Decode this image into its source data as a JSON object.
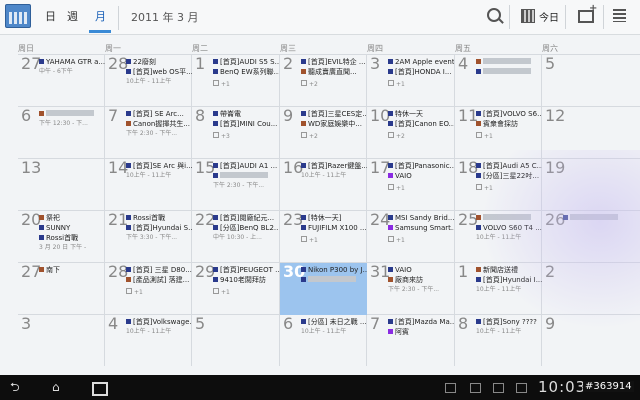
{
  "topbar": {
    "views": [
      {
        "label": "日"
      },
      {
        "label": "週"
      },
      {
        "label": "月"
      }
    ],
    "month_title": "2011 年 3 月",
    "today_label": "今日",
    "icons": {
      "search": "search-icon",
      "today": "calendar-today-icon",
      "add": "add-event-icon",
      "menu": "menu-icon"
    }
  },
  "colors": {
    "today_bg": "#9cc4ee",
    "accent": "#3a8ad6",
    "navy": "#2a3a8c",
    "brown": "#a0522d",
    "purple": "#8a2be2"
  },
  "days_of_week": [
    "周日",
    "周一",
    "周二",
    "周三",
    "周四",
    "周五",
    "周六"
  ],
  "weeks": [
    [
      {
        "num": "27",
        "events": [
          {
            "t": "YAHAMA GTR a...",
            "c": "navy"
          }
        ],
        "sub": "中午 - 6下午"
      },
      {
        "num": "28",
        "events": [
          {
            "t": "22廢刻",
            "c": "navy"
          },
          {
            "t": "[首頁]web OS平...",
            "c": "navy"
          }
        ],
        "sub": "10上午 - 11上午"
      },
      {
        "num": "1",
        "events": [
          {
            "t": "[首頁]AUDI S5 S...",
            "c": "navy"
          },
          {
            "t": "BenQ EW系列聯...",
            "c": "navy"
          }
        ],
        "more": "+1"
      },
      {
        "num": "2",
        "events": [
          {
            "t": "[首頁]EVIL特企 ...",
            "c": "navy"
          },
          {
            "t": "聽成賣廣直聞...",
            "c": "brown"
          }
        ],
        "more": "+2"
      },
      {
        "num": "3",
        "events": [
          {
            "t": "2AM Apple event",
            "c": "navy"
          },
          {
            "t": "[首頁]HONDA I...",
            "c": "navy"
          }
        ],
        "more": "+1"
      },
      {
        "num": "4",
        "events": [
          {
            "t": "",
            "c": "brown"
          },
          {
            "t": "",
            "c": "navy"
          }
        ]
      },
      {
        "num": "5",
        "events": []
      }
    ],
    [
      {
        "num": "6",
        "events": [
          {
            "t": "",
            "c": "brown"
          }
        ],
        "sub": "下午 12:30 - 下..."
      },
      {
        "num": "7",
        "events": [
          {
            "t": "[首頁] SE Arc...",
            "c": "navy"
          },
          {
            "t": "Canon握揮共生...",
            "c": "brown"
          }
        ],
        "sub": "下午 2:30 - 下午..."
      },
      {
        "num": "8",
        "events": [
          {
            "t": "帶崙電",
            "c": "navy"
          },
          {
            "t": "[首頁]MINI Cou...",
            "c": "navy"
          }
        ],
        "more": "+3"
      },
      {
        "num": "9",
        "events": [
          {
            "t": "[首頁]三星CES定...",
            "c": "navy"
          },
          {
            "t": "WD家庭娛樂中...",
            "c": "brown"
          }
        ],
        "more": "+2"
      },
      {
        "num": "10",
        "events": [
          {
            "t": "特休一天",
            "c": "navy"
          },
          {
            "t": "[首頁]Canon EO...",
            "c": "navy"
          }
        ],
        "more": "+2"
      },
      {
        "num": "11",
        "events": [
          {
            "t": "[首頁]VOLVO S6...",
            "c": "navy"
          },
          {
            "t": "賓衆會採訪",
            "c": "brown"
          }
        ],
        "more": "+1"
      },
      {
        "num": "12",
        "events": []
      }
    ],
    [
      {
        "num": "13",
        "events": []
      },
      {
        "num": "14",
        "events": [
          {
            "t": "[首頁]SE Arc 與i...",
            "c": "navy"
          }
        ],
        "sub": "10上午 - 11上午"
      },
      {
        "num": "15",
        "events": [
          {
            "t": "[首頁]AUDI A1 ...",
            "c": "navy"
          },
          {
            "t": "",
            "c": "navy"
          }
        ],
        "sub": "下午 2:30 - 下午..."
      },
      {
        "num": "16",
        "events": [
          {
            "t": "[首頁]Razer鍵盤...",
            "c": "navy"
          }
        ],
        "sub": "10上午 - 11上午"
      },
      {
        "num": "17",
        "events": [
          {
            "t": "[首頁]Panasonic...",
            "c": "navy"
          },
          {
            "t": "VAIO",
            "c": "purple"
          }
        ],
        "more": "+1"
      },
      {
        "num": "18",
        "events": [
          {
            "t": "[首頁]Audi A5 C...",
            "c": "navy"
          },
          {
            "t": "[分區]三星22吋...",
            "c": "navy"
          }
        ],
        "more": "+1"
      },
      {
        "num": "19",
        "events": []
      }
    ],
    [
      {
        "num": "20",
        "events": [
          {
            "t": "祭祀",
            "c": "brown"
          },
          {
            "t": "SUNNY",
            "c": "navy"
          },
          {
            "t": "Rossi首戰",
            "c": "navy"
          }
        ],
        "sub": "3 月 20 日 下午 -"
      },
      {
        "num": "21",
        "events": [
          {
            "t": "Rossi首戰",
            "c": "navy"
          },
          {
            "t": "[首頁]Hyundai S...",
            "c": "navy"
          }
        ],
        "sub": "下午 3:30 - 下午..."
      },
      {
        "num": "22",
        "events": [
          {
            "t": "[首頁]閱廠紀元...",
            "c": "navy"
          },
          {
            "t": "[分區]BenQ BL2...",
            "c": "navy"
          }
        ],
        "sub": "中午 10:30 - 上..."
      },
      {
        "num": "23",
        "events": [
          {
            "t": "[特休一天]",
            "c": "navy"
          },
          {
            "t": "FUJIFILM X100 ...",
            "c": "navy"
          }
        ],
        "more": "+1"
      },
      {
        "num": "24",
        "events": [
          {
            "t": "MSI Sandy Brid...",
            "c": "navy"
          },
          {
            "t": "Samsung Smart...",
            "c": "purple"
          }
        ],
        "more": "+1"
      },
      {
        "num": "25",
        "events": [
          {
            "t": "",
            "c": "brown"
          },
          {
            "t": "VOLVO S60 T4 ...",
            "c": "navy"
          }
        ],
        "sub": "10上午 - 11上午"
      },
      {
        "num": "26",
        "events": [
          {
            "t": "",
            "c": "navy"
          }
        ]
      }
    ],
    [
      {
        "num": "27",
        "events": [
          {
            "t": "南下",
            "c": "brown"
          }
        ]
      },
      {
        "num": "28",
        "events": [
          {
            "t": "[首頁] 三星 D80...",
            "c": "navy"
          },
          {
            "t": "[產品測試] 落建...",
            "c": "brown"
          }
        ],
        "more": "+1"
      },
      {
        "num": "29",
        "events": [
          {
            "t": "[首頁]PEUGEOT ...",
            "c": "navy"
          },
          {
            "t": "9410老闆拜訪",
            "c": "navy"
          }
        ],
        "more": "+1"
      },
      {
        "num": "30",
        "today": true,
        "events": [
          {
            "t": "Nikon P300 by J...",
            "c": "navy"
          },
          {
            "t": "",
            "c": "navy"
          }
        ]
      },
      {
        "num": "31",
        "events": [
          {
            "t": "VAIO",
            "c": "navy"
          },
          {
            "t": "廠商來訪",
            "c": "brown"
          }
        ],
        "sub": "下午 2:30 - 下午..."
      },
      {
        "num": "1",
        "events": [
          {
            "t": "新聞店送禮",
            "c": "brown"
          },
          {
            "t": "[首頁]Hyundai I...",
            "c": "navy"
          }
        ],
        "sub": "10上午 - 11上午"
      },
      {
        "num": "2",
        "events": []
      }
    ],
    [
      {
        "num": "3",
        "events": []
      },
      {
        "num": "4",
        "events": [
          {
            "t": "[首頁]Volkswage...",
            "c": "navy"
          }
        ],
        "sub": "10上午 - 11上午"
      },
      {
        "num": "5",
        "events": []
      },
      {
        "num": "6",
        "events": [
          {
            "t": "[分區] 未日之戰 ...",
            "c": "navy"
          }
        ],
        "sub": "10上午 - 11上午"
      },
      {
        "num": "7",
        "events": [
          {
            "t": "[首頁]Mazda Ma...",
            "c": "navy"
          },
          {
            "t": "阿賓",
            "c": "purple"
          }
        ]
      },
      {
        "num": "8",
        "events": [
          {
            "t": "[首頁]Sony ????",
            "c": "navy"
          }
        ],
        "sub": "10上午 - 11上午"
      },
      {
        "num": "9",
        "events": []
      }
    ]
  ],
  "statusbar": {
    "clock": "10:03"
  },
  "watermark": "#363914"
}
